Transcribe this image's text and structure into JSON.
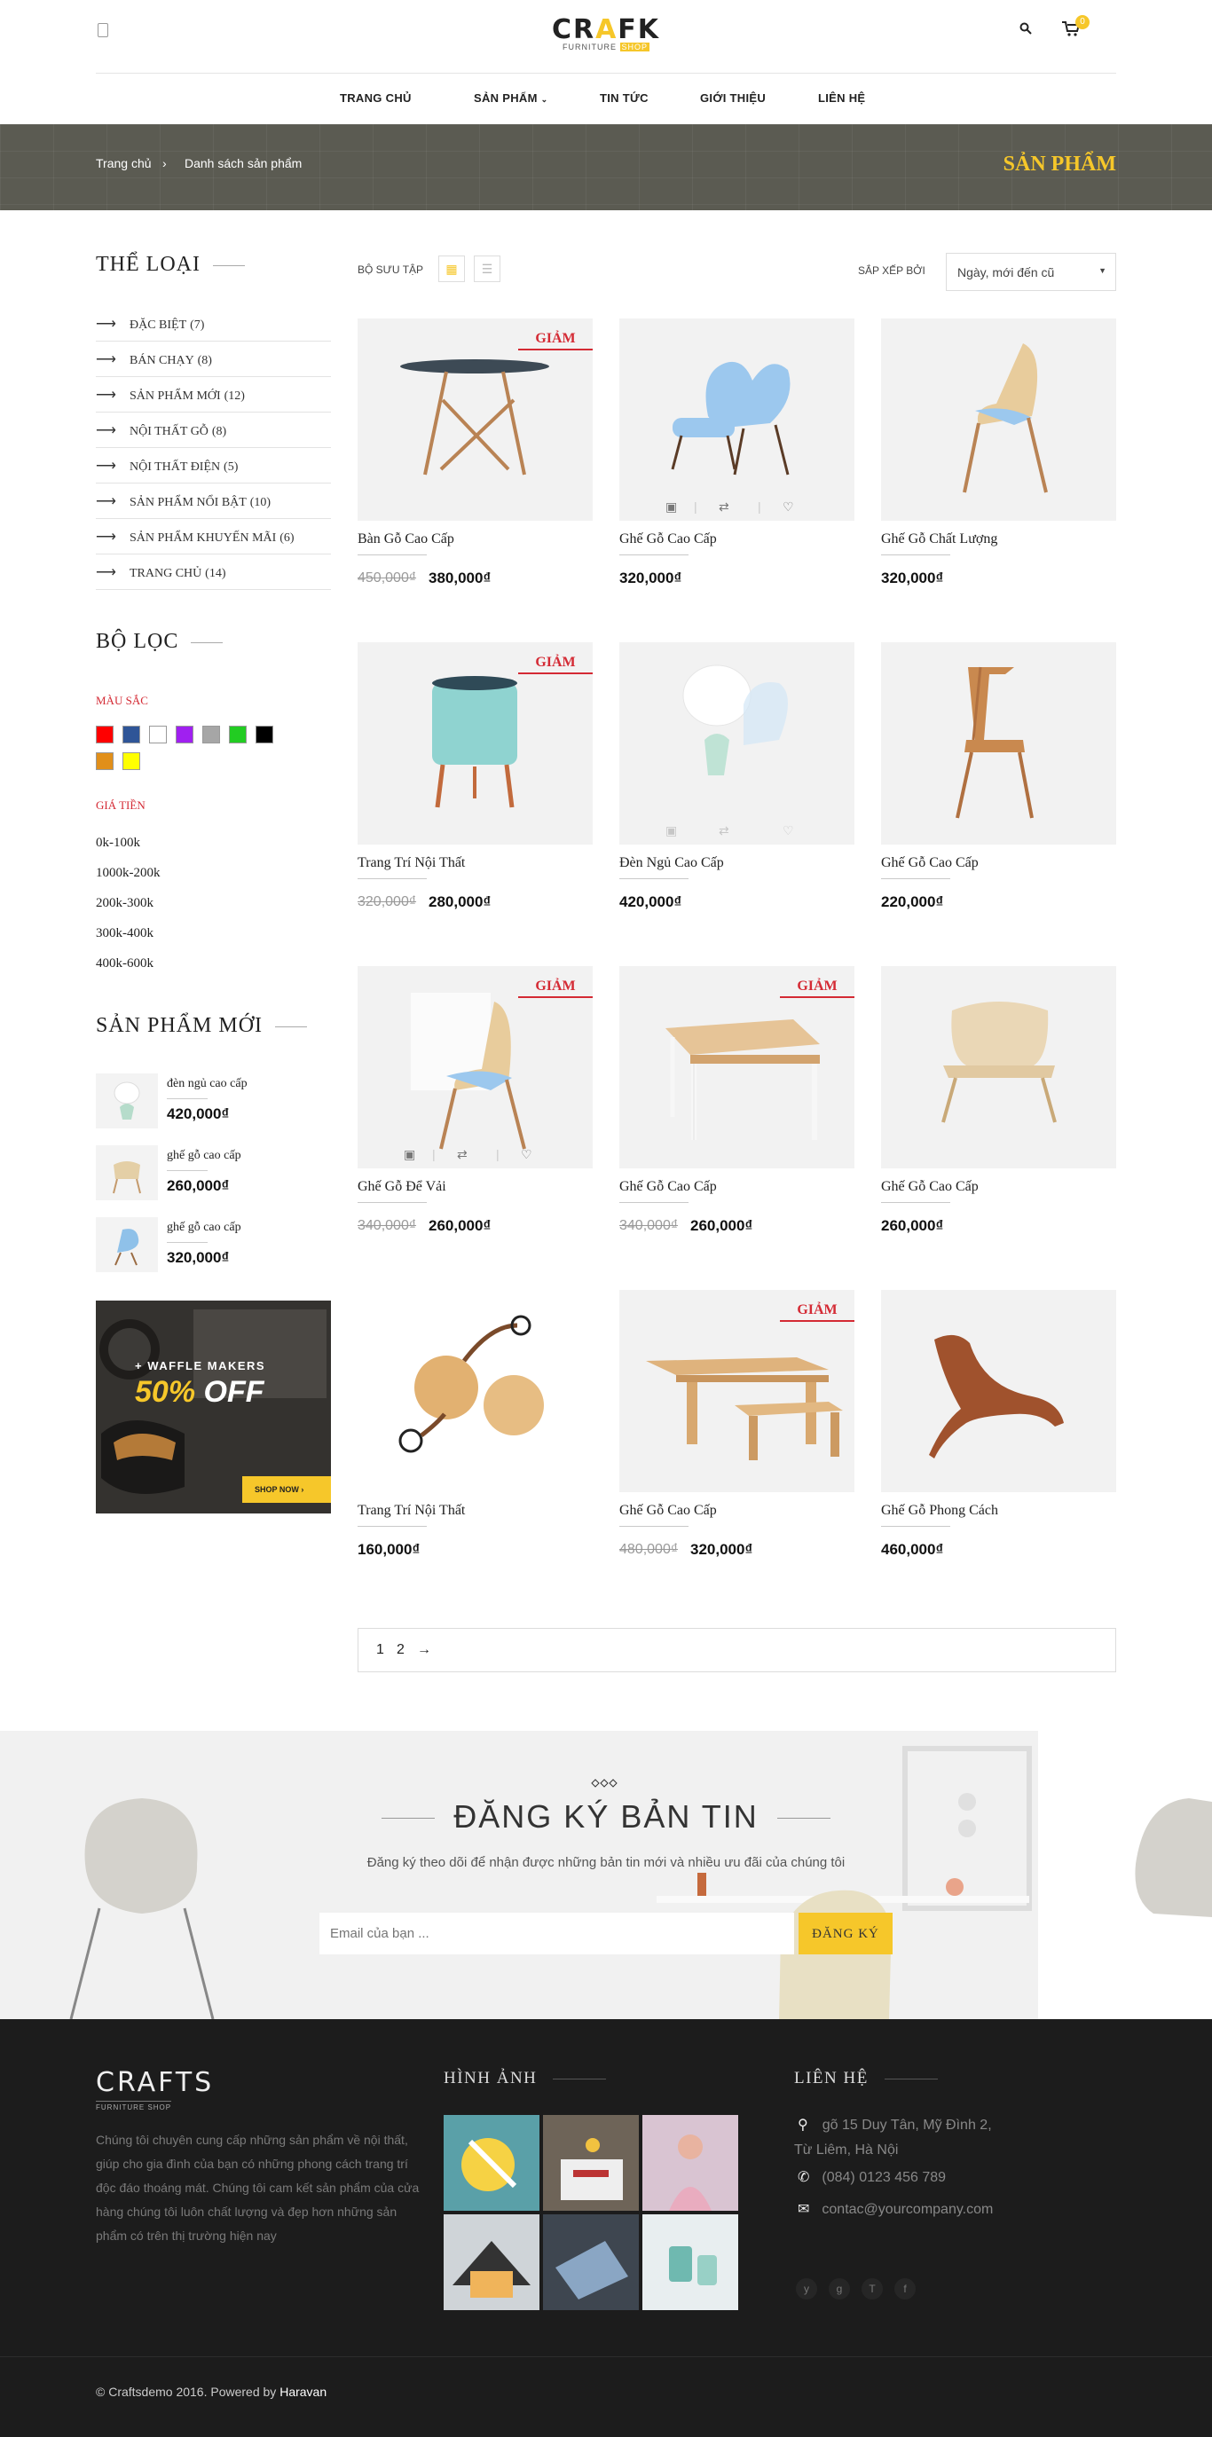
{
  "header": {
    "logo_main_pre": "CR",
    "logo_main_y": "A",
    "logo_main_post": "FK",
    "logo_sub": "FURNITURE",
    "logo_sub_tag": "SHOP",
    "cart_count": "0",
    "nav": [
      "TRANG CHỦ",
      "SẢN PHẨM",
      "TIN TỨC",
      "GIỚI THIỆU",
      "LIÊN HỆ"
    ]
  },
  "breadcrumb": {
    "home": "Trang chủ",
    "current": "Danh sách sản phẩm",
    "title": "SẢN PHẨM"
  },
  "sidebar": {
    "categories_title": "THỂ LOẠI",
    "categories": [
      {
        "label": "ĐẶC BIỆT",
        "count": "(7)"
      },
      {
        "label": "BÁN CHẠY",
        "count": "(8)"
      },
      {
        "label": "SẢN PHẨM MỚI",
        "count": "(12)"
      },
      {
        "label": "NỘI THẤT GỖ",
        "count": "(8)"
      },
      {
        "label": "NỘI THẤT ĐIỆN",
        "count": "(5)"
      },
      {
        "label": "SẢN PHẨM NỔI BẬT",
        "count": "(10)"
      },
      {
        "label": "SẢN PHẨM KHUYẾN MÃI",
        "count": "(6)"
      },
      {
        "label": "TRANG CHỦ",
        "count": "(14)"
      }
    ],
    "filter_title": "BỘ LỌC",
    "color_label": "MÀU SẮC",
    "colors": [
      "#ff0000",
      "#2f5597",
      "#ffffff",
      "#a020f0",
      "#a6a6a6",
      "#22cc22",
      "#000000",
      "#e18f1a",
      "#ffff00"
    ],
    "price_label": "GIÁ TIỀN",
    "prices": [
      "0k-100k",
      "1000k-200k",
      "200k-300k",
      "300k-400k",
      "400k-600k"
    ],
    "new_title": "SẢN PHẨM MỚI",
    "new_products": [
      {
        "name": "đèn ngủ cao cấp",
        "price": "420,000₫"
      },
      {
        "name": "ghế gỗ cao cấp",
        "price": "260,000₫"
      },
      {
        "name": "ghế gỗ cao cấp",
        "price": "320,000₫"
      }
    ],
    "banner": {
      "line1": "+ WAFFLE MAKERS",
      "line2_num": "50%",
      "line2_text": "OFF",
      "button": "SHOP NOW"
    }
  },
  "toolbar": {
    "view_label": "BỘ SƯU TẬP",
    "sort_label": "SẮP XẾP BỞI",
    "sort_value": "Ngày, mới đến cũ"
  },
  "products": [
    {
      "name": "Bàn Gỗ Cao Cấp",
      "old": "450,000₫",
      "price": "380,000₫",
      "tag": "GIẢM"
    },
    {
      "name": "Ghế Gỗ Cao Cấp",
      "old": "",
      "price": "320,000₫",
      "tag": ""
    },
    {
      "name": "Ghế Gỗ Chất Lượng",
      "old": "",
      "price": "320,000₫",
      "tag": ""
    },
    {
      "name": "Trang Trí Nội Thất",
      "old": "320,000₫",
      "price": "280,000₫",
      "tag": "GIẢM"
    },
    {
      "name": "Đèn Ngủ Cao Cấp",
      "old": "",
      "price": "420,000₫",
      "tag": ""
    },
    {
      "name": "Ghế Gỗ Cao Cấp",
      "old": "",
      "price": "220,000₫",
      "tag": ""
    },
    {
      "name": "Ghế Gỗ Để Vải",
      "old": "340,000₫",
      "price": "260,000₫",
      "tag": "GIẢM"
    },
    {
      "name": "Ghế Gỗ Cao Cấp",
      "old": "340,000₫",
      "price": "260,000₫",
      "tag": "GIẢM"
    },
    {
      "name": "Ghế Gỗ Cao Cấp",
      "old": "",
      "price": "260,000₫",
      "tag": ""
    },
    {
      "name": "Trang Trí Nội Thất",
      "old": "",
      "price": "160,000₫",
      "tag": ""
    },
    {
      "name": "Ghế Gỗ Cao Cấp",
      "old": "480,000₫",
      "price": "320,000₫",
      "tag": "GIẢM"
    },
    {
      "name": "Ghế Gỗ Phong Cách",
      "old": "",
      "price": "460,000₫",
      "tag": ""
    }
  ],
  "pagination": {
    "p1": "1",
    "p2": "2",
    "next": "→"
  },
  "newsletter": {
    "title": "ĐĂNG KÝ BẢN TIN",
    "desc": "Đăng ký theo dõi để nhận được những bản tin mới và nhiều ưu đãi của chúng tôi",
    "placeholder": "Email của bạn ...",
    "button": "ĐĂNG KÝ"
  },
  "footer": {
    "logo": "CRAFTS",
    "logo_sub": "FURNITURE SHOP",
    "about": "Chúng tôi chuyên cung cấp những sản phẩm về nội thất, giúp cho gia đình của bạn có những phong cách trang trí độc đáo thoáng mát. Chúng tôi cam kết sản phẩm của cửa hàng chúng tôi luôn chất lượng và đẹp hơn những sản phẩm có trên thị trường hiện nay",
    "gallery_title": "HÌNH ẢNH",
    "contact_title": "LIÊN HỆ",
    "address1": "gõ 15 Duy Tân, Mỹ Đình 2,",
    "address2": "Từ Liêm, Hà Nội",
    "phone": "(084) 0123 456 789",
    "email": "contac@yourcompany.com",
    "social": [
      "y",
      "g",
      "T",
      "f"
    ],
    "copyright": "© Craftsdemo 2016. Powered by",
    "powered": "Haravan"
  },
  "colors": {
    "accent": "#f6c72a",
    "sale": "#d42a34",
    "footer_bg": "#1c1c1c"
  }
}
